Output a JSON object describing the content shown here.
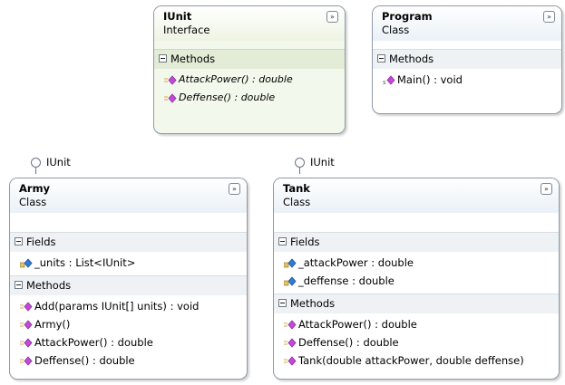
{
  "collapse_glyph": "»",
  "section_labels": {
    "fields": "Fields",
    "methods": "Methods"
  },
  "colors": {
    "border": "#8f9aa6",
    "interface_fill": "#f3f8ec",
    "method_icon": "#c24bd6",
    "field_icon": "#2f7bd8"
  },
  "classes": [
    {
      "key": "iunit",
      "name": "IUnit",
      "kind": "Interface",
      "fields": [],
      "methods": [
        {
          "label": "AttackPower() : double"
        },
        {
          "label": "Deffense() : double"
        }
      ]
    },
    {
      "key": "program",
      "name": "Program",
      "kind": "Class",
      "fields": [],
      "methods": [
        {
          "label": "Main() : void"
        }
      ]
    },
    {
      "key": "army",
      "name": "Army",
      "kind": "Class",
      "lollipop": "IUnit",
      "fields": [
        {
          "label": "_units : List<IUnit>"
        }
      ],
      "methods": [
        {
          "label": "Add(params IUnit[] units) : void"
        },
        {
          "label": "Army()"
        },
        {
          "label": "AttackPower() : double"
        },
        {
          "label": "Deffense() : double"
        }
      ]
    },
    {
      "key": "tank",
      "name": "Tank",
      "kind": "Class",
      "lollipop": "IUnit",
      "fields": [
        {
          "label": "_attackPower : double"
        },
        {
          "label": "_deffense : double"
        }
      ],
      "methods": [
        {
          "label": "AttackPower() : double"
        },
        {
          "label": "Deffense() : double"
        },
        {
          "label": "Tank(double attackPower, double deffense)"
        }
      ]
    }
  ]
}
